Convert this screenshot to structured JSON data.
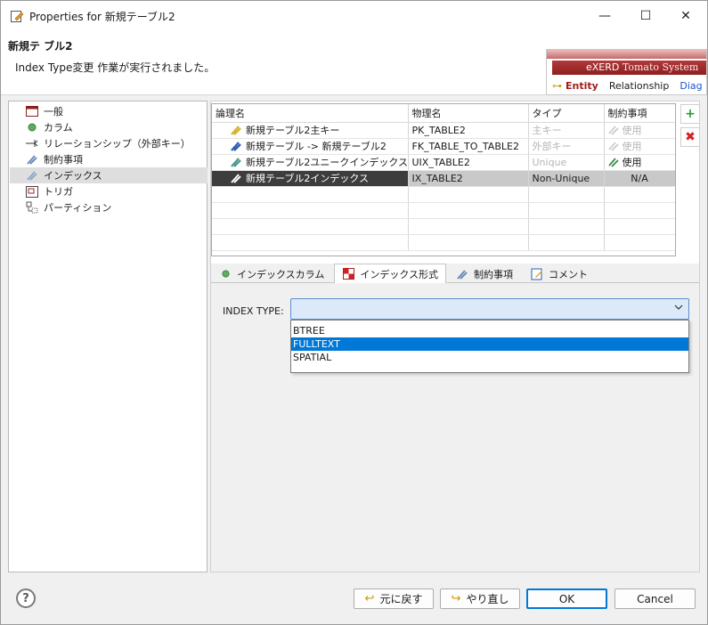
{
  "window": {
    "title": "Properties for 新規テーブル2",
    "minimize": "—",
    "maximize": "☐",
    "close": "✕"
  },
  "header": {
    "title": "新規テ ブル2",
    "message": "Index Type変更 作業が実行されました。"
  },
  "exerd": {
    "brand": "eXERD",
    "brand_sub": "Tomato System",
    "tabs": [
      "Entity",
      "Relationship",
      "Diag"
    ]
  },
  "tree": {
    "items": [
      {
        "label": "一般",
        "icon": "general-icon"
      },
      {
        "label": "カラム",
        "icon": "column-icon"
      },
      {
        "label": "リレーションシップ（外部キー）",
        "icon": "relationship-icon"
      },
      {
        "label": "制約事項",
        "icon": "constraint-icon"
      },
      {
        "label": "インデックス",
        "icon": "index-icon"
      },
      {
        "label": "トリガ",
        "icon": "trigger-icon"
      },
      {
        "label": "パーティション",
        "icon": "partition-icon"
      }
    ],
    "selected_index": 4
  },
  "grid": {
    "headers": [
      "論理名",
      "物理名",
      "タイプ",
      "制約事項"
    ],
    "rows": [
      {
        "logical": "新規テーブル2主キー",
        "physical": "PK_TABLE2",
        "type": "主キー",
        "constraint": "使用"
      },
      {
        "logical": "新規テーブル -> 新規テーブル2",
        "physical": "FK_TABLE_TO_TABLE2",
        "type": "外部キー",
        "constraint": "使用"
      },
      {
        "logical": "新規テーブル2ユニークインデックス",
        "physical": "UIX_TABLE2",
        "type": "Unique",
        "constraint": "使用"
      },
      {
        "logical": "新規テーブル2インデックス",
        "physical": "IX_TABLE2",
        "type": "Non-Unique",
        "constraint": "N/A"
      }
    ],
    "add": "+",
    "remove": "✖"
  },
  "tabs": [
    {
      "label": "インデックスカラム",
      "icon": "column-icon"
    },
    {
      "label": "インデックス形式",
      "icon": "index-type-icon"
    },
    {
      "label": "制約事項",
      "icon": "constraint-icon"
    },
    {
      "label": "コメント",
      "icon": "comment-icon"
    }
  ],
  "index_type": {
    "label": "INDEX TYPE:",
    "value": "",
    "options": [
      "BTREE",
      "FULLTEXT",
      "SPATIAL"
    ],
    "highlighted": "FULLTEXT"
  },
  "footer": {
    "help": "?",
    "undo": "元に戻す",
    "redo": "やり直し",
    "ok": "OK",
    "cancel": "Cancel"
  },
  "colors": {
    "accent": "#0078d7",
    "select_bg": "#dbe9f8",
    "selected_row": "#3d3d3d"
  }
}
